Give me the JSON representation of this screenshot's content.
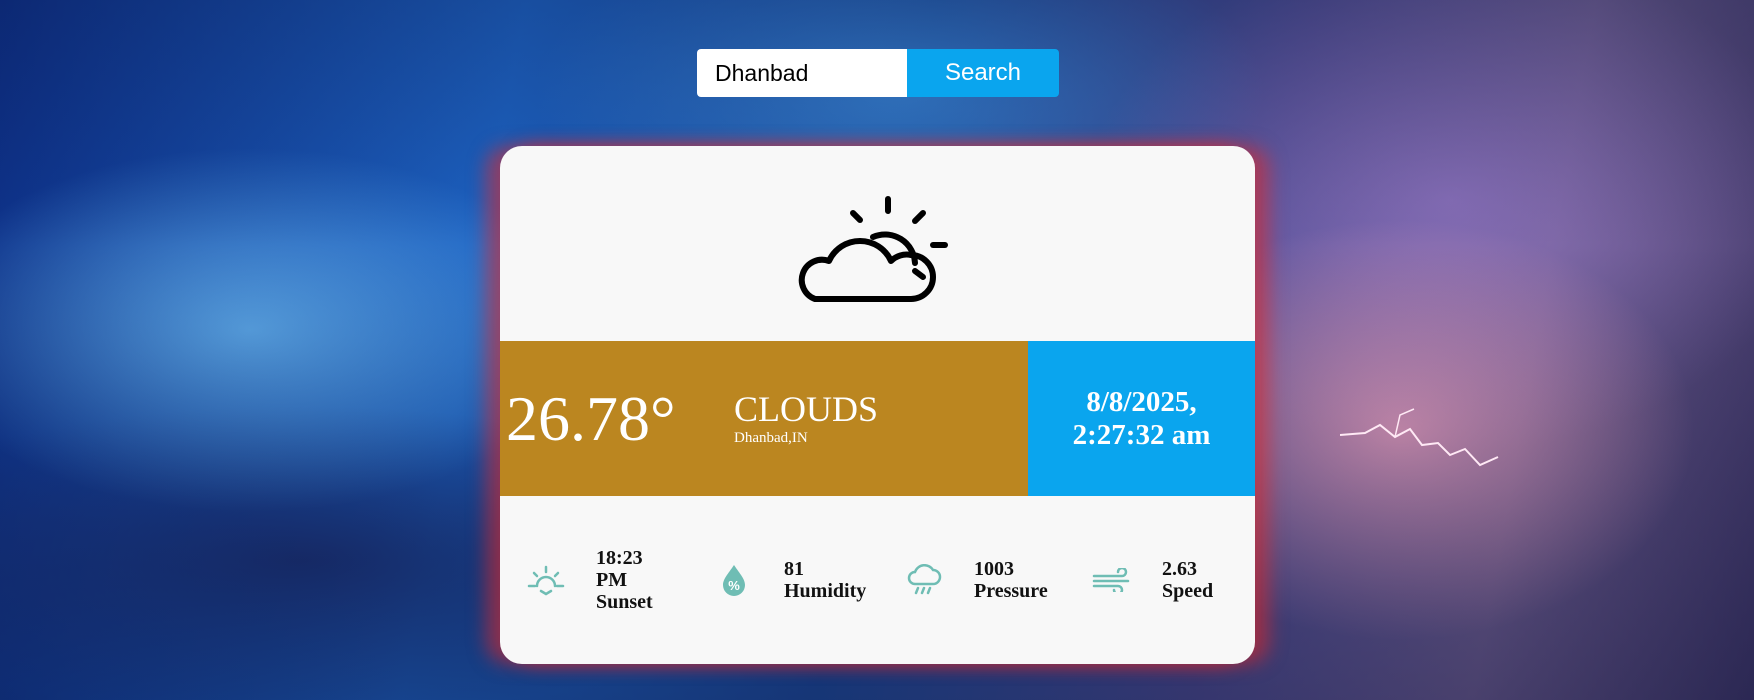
{
  "search": {
    "value": "Dhanbad",
    "button_label": "Search"
  },
  "weather": {
    "icon": "partly-cloudy-icon",
    "temperature": "26.78°",
    "condition": "CLOUDS",
    "location": "Dhanbad,IN",
    "date": "8/8/2025,",
    "time": "2:27:32 am"
  },
  "stats": [
    {
      "icon": "sunset-icon",
      "value": "18:23\nPM",
      "label": "Sunset"
    },
    {
      "icon": "humidity-icon",
      "value": "81",
      "label": "Humidity"
    },
    {
      "icon": "pressure-icon",
      "value": "1003",
      "label": "Pressure"
    },
    {
      "icon": "wind-icon",
      "value": "2.63",
      "label": "Speed"
    }
  ],
  "colors": {
    "accent_blue": "#0aa5ee",
    "temperature_panel": "#bb8620",
    "stat_icon_teal": "#6fbdb4",
    "card_background": "#f8f8f8"
  }
}
